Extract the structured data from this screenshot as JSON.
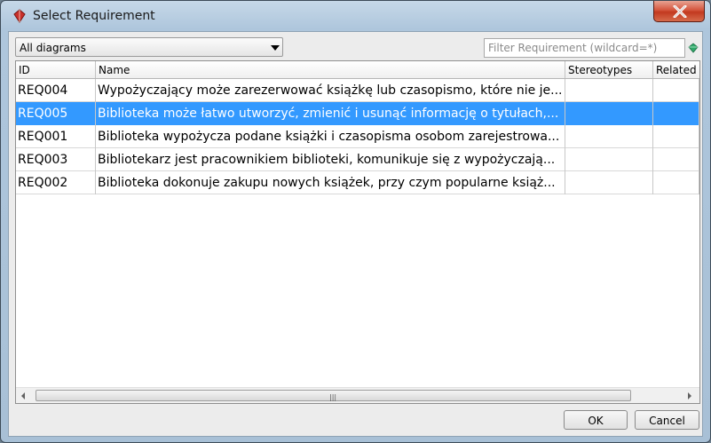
{
  "window": {
    "title": "Select Requirement",
    "close_icon": "close-icon",
    "app_icon": "requirement-icon"
  },
  "toolbar": {
    "diagram_filter_value": "All diagrams",
    "filter_placeholder": "Filter Requirement (wildcard=*)",
    "filter_icon": "gem-icon"
  },
  "table": {
    "columns": [
      "ID",
      "Name",
      "Stereotypes",
      "Related u"
    ],
    "rows": [
      {
        "id": "REQ004",
        "name": "Wypożyczający może zarezerwować książkę lub czasopismo, które nie je...",
        "stereotypes": "",
        "related": "",
        "selected": false
      },
      {
        "id": "REQ005",
        "name": "Biblioteka może łatwo utworzyć, zmienić i usunąć informację o tytułach,...",
        "stereotypes": "",
        "related": "",
        "selected": true
      },
      {
        "id": "REQ001",
        "name": "Biblioteka wypożycza podane książki i czasopisma osobom zarejestrowa...",
        "stereotypes": "",
        "related": "",
        "selected": false
      },
      {
        "id": "REQ003",
        "name": "Bibliotekarz jest pracownikiem biblioteki, komunikuje się z wypożyczają...",
        "stereotypes": "",
        "related": "",
        "selected": false
      },
      {
        "id": "REQ002",
        "name": "Biblioteka dokonuje zakupu nowych książek, przy czym popularne książ...",
        "stereotypes": "",
        "related": "",
        "selected": false
      }
    ],
    "selection_color": "#3399ff"
  },
  "buttons": {
    "ok": "OK",
    "cancel": "Cancel"
  }
}
